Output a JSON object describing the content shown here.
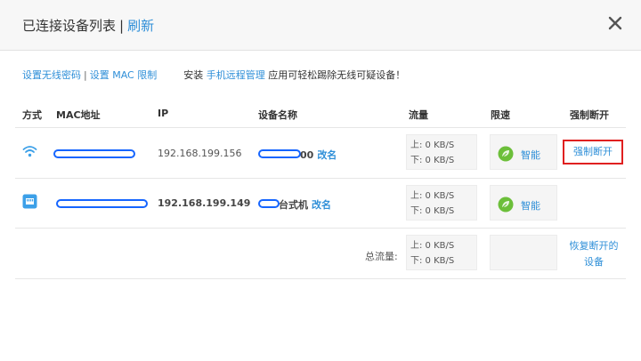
{
  "header": {
    "title": "已连接设备列表",
    "separator": "|",
    "refresh_label": "刷新",
    "close_symbol": "✕"
  },
  "links": {
    "set_wifi_password": "设置无线密码",
    "separator": "|",
    "set_mac_limit": "设置 MAC 限制",
    "install_prefix": "安装",
    "remote_app": "手机远程管理",
    "install_suffix": "应用可轻松踢除无线可疑设备！"
  },
  "table": {
    "headers": {
      "method": "方式",
      "mac": "MAC地址",
      "ip": "IP",
      "device_name": "设备名称",
      "traffic": "流量",
      "speed_limit": "限速",
      "force_disconnect": "强制断开"
    },
    "rows": [
      {
        "connection_type": "wifi-icon",
        "ip": "192.168.199.156",
        "name_suffix": "00",
        "rename_label": "改名",
        "up": "上: 0 KB/S",
        "down": "下: 0 KB/S",
        "limit_label": "智能",
        "disconnect_label": "强制断开"
      },
      {
        "connection_type": "ethernet-icon",
        "ip": "192.168.199.149",
        "name_suffix": "台式机",
        "rename_label": "改名",
        "up": "上: 0 KB/S",
        "down": "下: 0 KB/S",
        "limit_label": "智能"
      }
    ],
    "total": {
      "label": "总流量:",
      "up": "上: 0 KB/S",
      "down": "下: 0 KB/S",
      "restore_label": "恢复断开的设备"
    }
  },
  "colors": {
    "link": "#2f8fd8",
    "icon_blue": "#3ca0e8",
    "leaf_green": "#6cbf3a",
    "highlight_red": "#e02020",
    "redaction_blue": "#1565ff"
  }
}
